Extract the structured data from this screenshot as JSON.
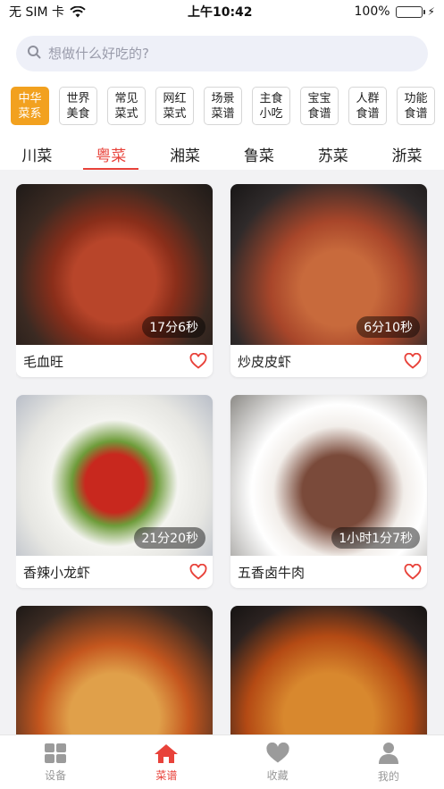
{
  "status_bar": {
    "carrier": "无 SIM 卡",
    "time": "上午10:42",
    "battery": "100%",
    "battery_level": 1.0
  },
  "search": {
    "placeholder": "想做什么好吃的?"
  },
  "categories": [
    {
      "label": "中华\n菜系",
      "active": true
    },
    {
      "label": "世界\n美食",
      "active": false
    },
    {
      "label": "常见\n菜式",
      "active": false
    },
    {
      "label": "网红\n菜式",
      "active": false
    },
    {
      "label": "场景\n菜谱",
      "active": false
    },
    {
      "label": "主食\n小吃",
      "active": false
    },
    {
      "label": "宝宝\n食谱",
      "active": false
    },
    {
      "label": "人群\n食谱",
      "active": false
    },
    {
      "label": "功能\n食谱",
      "active": false
    }
  ],
  "tabs": [
    {
      "label": "川菜",
      "active": false
    },
    {
      "label": "粤菜",
      "active": true
    },
    {
      "label": "湘菜",
      "active": false
    },
    {
      "label": "鲁菜",
      "active": false
    },
    {
      "label": "苏菜",
      "active": false
    },
    {
      "label": "浙菜",
      "active": false
    }
  ],
  "recipes": [
    {
      "title": "毛血旺",
      "duration": "17分6秒"
    },
    {
      "title": "炒皮皮虾",
      "duration": "6分10秒"
    },
    {
      "title": "香辣小龙虾",
      "duration": "21分20秒"
    },
    {
      "title": "五香卤牛肉",
      "duration": "1小时1分7秒"
    },
    {
      "title": "",
      "duration": ""
    },
    {
      "title": "",
      "duration": ""
    }
  ],
  "nav": [
    {
      "label": "设备",
      "icon": "grid-icon",
      "active": false
    },
    {
      "label": "菜谱",
      "icon": "home-icon",
      "active": true
    },
    {
      "label": "收藏",
      "icon": "heart-icon",
      "active": false
    },
    {
      "label": "我的",
      "icon": "user-icon",
      "active": false
    }
  ],
  "colors": {
    "accent": "#e8423a",
    "category_active": "#f2a11f",
    "battery": "#34c759"
  }
}
